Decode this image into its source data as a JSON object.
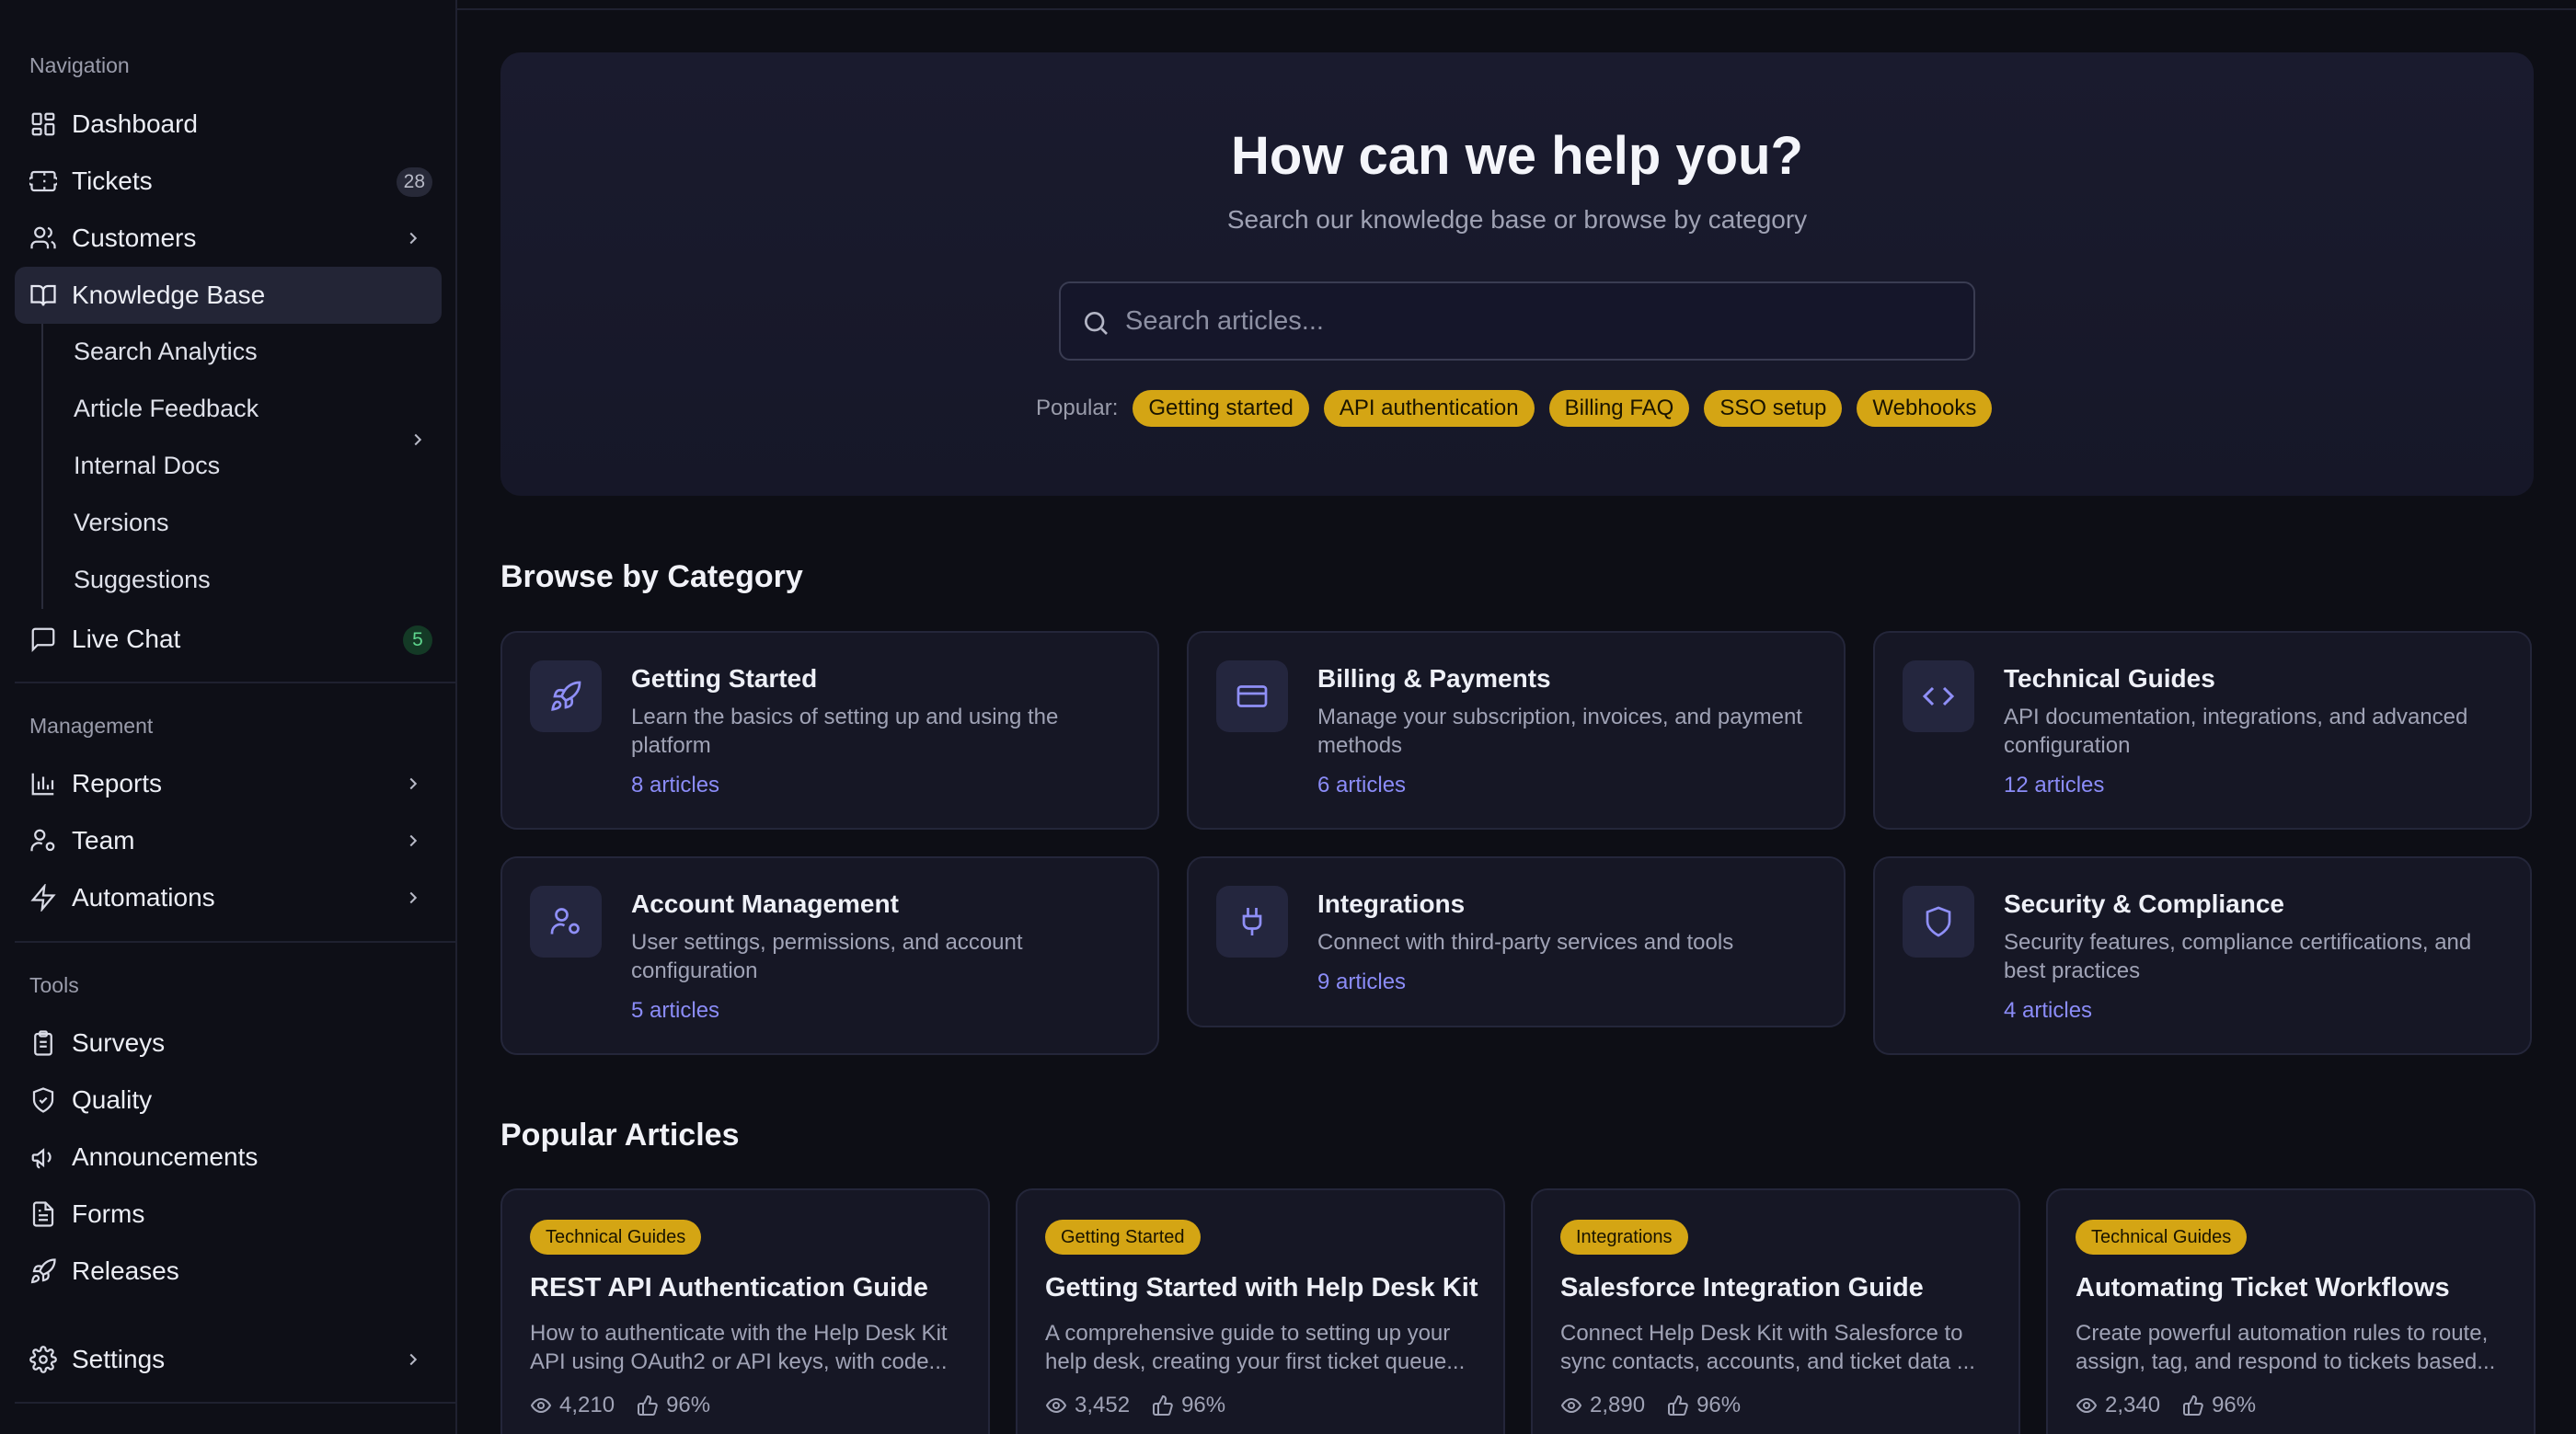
{
  "sidebar": {
    "sections": {
      "navigation": "Navigation",
      "management": "Management",
      "tools": "Tools"
    },
    "nav": {
      "dashboard": "Dashboard",
      "tickets": "Tickets",
      "tickets_badge": "28",
      "customers": "Customers",
      "knowledge_base": "Knowledge Base",
      "live_chat": "Live Chat",
      "live_chat_badge": "5"
    },
    "kb_sub": [
      "Search Analytics",
      "Article Feedback",
      "Internal Docs",
      "Versions",
      "Suggestions"
    ],
    "management": {
      "reports": "Reports",
      "team": "Team",
      "automations": "Automations"
    },
    "tools": {
      "surveys": "Surveys",
      "quality": "Quality",
      "announcements": "Announcements",
      "forms": "Forms",
      "releases": "Releases"
    },
    "settings": "Settings"
  },
  "hero": {
    "title": "How can we help you?",
    "subtitle": "Search our knowledge base or browse by category",
    "search_placeholder": "Search articles...",
    "popular_label": "Popular:",
    "popular_chips": [
      "Getting started",
      "API authentication",
      "Billing FAQ",
      "SSO setup",
      "Webhooks"
    ]
  },
  "categories": {
    "heading": "Browse by Category",
    "items": [
      {
        "title": "Getting Started",
        "description": "Learn the basics of setting up and using the platform",
        "count": "8 articles",
        "icon": "rocket-icon"
      },
      {
        "title": "Billing & Payments",
        "description": "Manage your subscription, invoices, and payment methods",
        "count": "6 articles",
        "icon": "credit-card-icon"
      },
      {
        "title": "Technical Guides",
        "description": "API documentation, integrations, and advanced configuration",
        "count": "12 articles",
        "icon": "code-icon"
      },
      {
        "title": "Account Management",
        "description": "User settings, permissions, and account configuration",
        "count": "5 articles",
        "icon": "user-cog-icon"
      },
      {
        "title": "Integrations",
        "description": "Connect with third-party services and tools",
        "count": "9 articles",
        "icon": "plug-icon"
      },
      {
        "title": "Security & Compliance",
        "description": "Security features, compliance certifications, and best practices",
        "count": "4 articles",
        "icon": "shield-icon"
      }
    ]
  },
  "popular_articles": {
    "heading": "Popular Articles",
    "items": [
      {
        "tag": "Technical Guides",
        "title": "REST API Authentication Guide",
        "description": "How to authenticate with the Help Desk Kit API using OAuth2 or API keys, with code...",
        "views": "4,210",
        "helpful": "96%"
      },
      {
        "tag": "Getting Started",
        "title": "Getting Started with Help Desk Kit",
        "description": "A comprehensive guide to setting up your help desk, creating your first ticket queue...",
        "views": "3,452",
        "helpful": "96%"
      },
      {
        "tag": "Integrations",
        "title": "Salesforce Integration Guide",
        "description": "Connect Help Desk Kit with Salesforce to sync contacts, accounts, and ticket data ...",
        "views": "2,890",
        "helpful": "96%"
      },
      {
        "tag": "Technical Guides",
        "title": "Automating Ticket Workflows",
        "description": "Create powerful automation rules to route, assign, tag, and respond to tickets based...",
        "views": "2,340",
        "helpful": "96%"
      }
    ]
  },
  "colors": {
    "background": "#0d0e15",
    "accent_chip": "#d4a514",
    "link": "#8b8cf8",
    "badge_green": "#5ed58d"
  }
}
